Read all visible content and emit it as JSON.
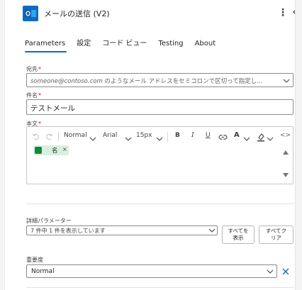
{
  "header": {
    "title": "メールの送信 (V2)",
    "app_icon": "outlook-icon",
    "more_icon": "more-vertical-icon",
    "collapse_icon": "chevron-left-icon"
  },
  "tabs": [
    {
      "label": "Parameters",
      "active": true
    },
    {
      "label": "設定",
      "active": false
    },
    {
      "label": "コード ビュー",
      "active": false
    },
    {
      "label": "Testing",
      "active": false
    },
    {
      "label": "About",
      "active": false
    }
  ],
  "fields": {
    "to": {
      "label": "宛先",
      "required_mark": "*",
      "placeholder_italic": "someone@contoso.com",
      "placeholder_rest": " のようなメール アドレスをセミコロンで区切って指定し..."
    },
    "subject": {
      "label": "件名",
      "required_mark": "*",
      "value": "テストメール"
    },
    "body": {
      "label": "本文",
      "required_mark": "*",
      "toolbar": {
        "format": "Normal",
        "font": "Arial",
        "size": "15px",
        "bold": "B",
        "italic": "I",
        "underline": "U",
        "font_color": "A",
        "code": "<>"
      },
      "token": {
        "label": "名",
        "close": "×"
      }
    },
    "advanced": {
      "label": "詳細パラメーター",
      "value": "7 件中 1 件を表示しています",
      "show_all_line1": "すべてを",
      "show_all_line2": "表示",
      "clear_all_line1": "すべてク",
      "clear_all_line2": "リア"
    },
    "importance": {
      "label": "重要度",
      "value": "Normal"
    }
  },
  "colors": {
    "accent": "#0f6cbd",
    "required": "#c50f1f",
    "token_bg": "#d9f0e0",
    "token_icon": "#0e8a3e"
  }
}
